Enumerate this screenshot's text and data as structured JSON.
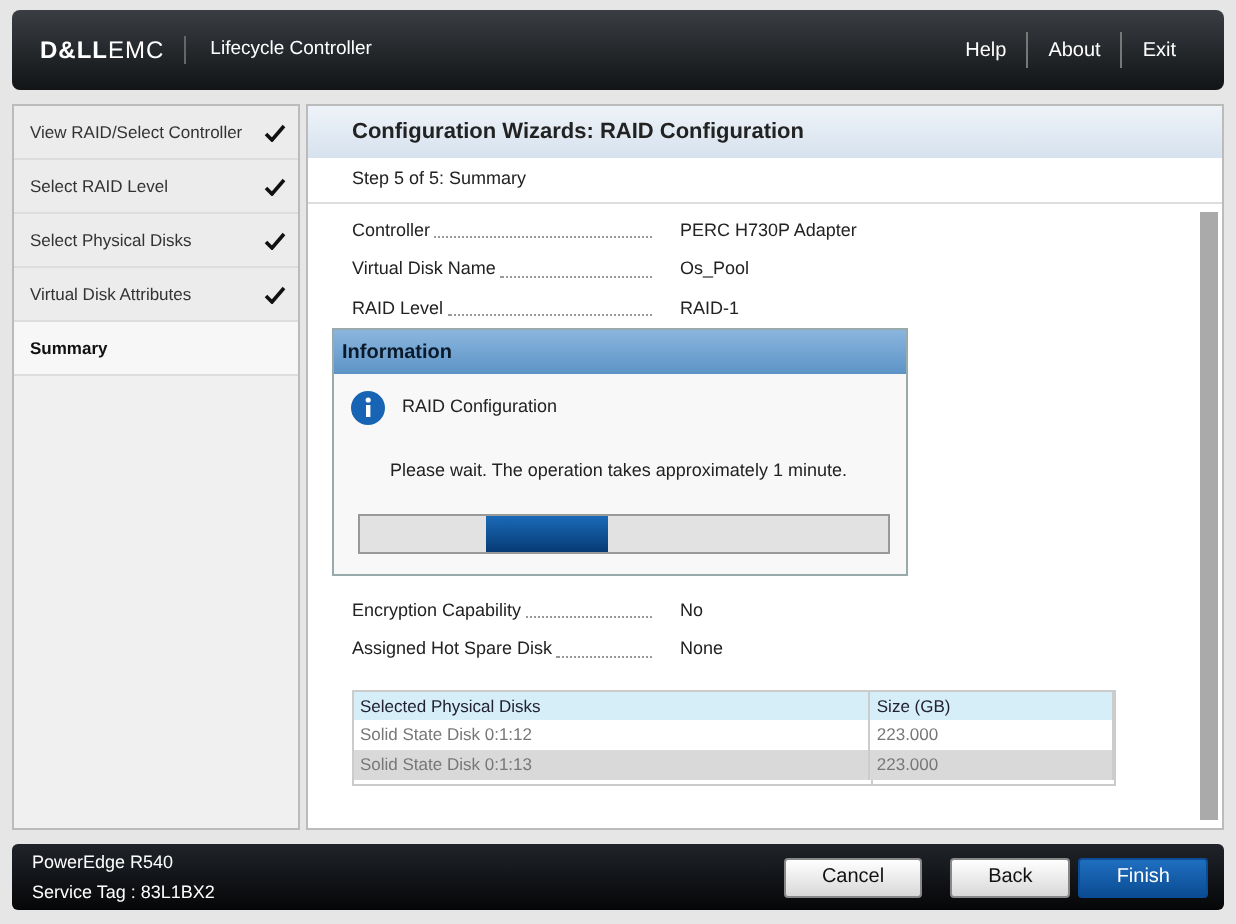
{
  "header": {
    "brand_bold": "D&LL",
    "brand_light": "EMC",
    "product": "Lifecycle Controller",
    "links": [
      "Help",
      "About",
      "Exit"
    ]
  },
  "sidebar": {
    "items": [
      {
        "label": "View RAID/Select Controller",
        "checked": true,
        "selected": false
      },
      {
        "label": "Select RAID Level",
        "checked": true,
        "selected": false
      },
      {
        "label": "Select Physical Disks",
        "checked": true,
        "selected": false
      },
      {
        "label": "Virtual Disk Attributes",
        "checked": true,
        "selected": false
      },
      {
        "label": "Summary",
        "checked": false,
        "selected": true
      }
    ]
  },
  "main": {
    "title": "Configuration Wizards: RAID Configuration",
    "step": "Step 5 of 5: Summary",
    "summary_top": [
      {
        "label": "Controller",
        "value": "PERC H730P Adapter"
      },
      {
        "label": "Virtual Disk Name",
        "value": "Os_Pool"
      },
      {
        "label": "RAID Level",
        "value": "RAID-1"
      }
    ],
    "summary_bottom": [
      {
        "label": "Encryption Capability",
        "value": "No"
      },
      {
        "label": "Assigned Hot Spare Disk",
        "value": "None"
      }
    ],
    "table": {
      "columns": [
        "Selected Physical Disks",
        "Size (GB)"
      ],
      "rows": [
        {
          "cells": [
            "Solid State Disk 0:1:12",
            "223.000"
          ],
          "selected": false
        },
        {
          "cells": [
            "Solid State Disk 0:1:13",
            "223.000"
          ],
          "selected": true
        }
      ]
    }
  },
  "dialog": {
    "title": "Information",
    "heading": "RAID Configuration",
    "message": "Please wait. The operation takes approximately 1 minute."
  },
  "footer": {
    "model": "PowerEdge R540",
    "service_tag": "Service Tag : 83L1BX2",
    "buttons": [
      {
        "label": "Cancel",
        "kind": "plain"
      },
      {
        "label": "Back",
        "kind": "plain"
      },
      {
        "label": "Finish",
        "kind": "primary"
      }
    ]
  }
}
